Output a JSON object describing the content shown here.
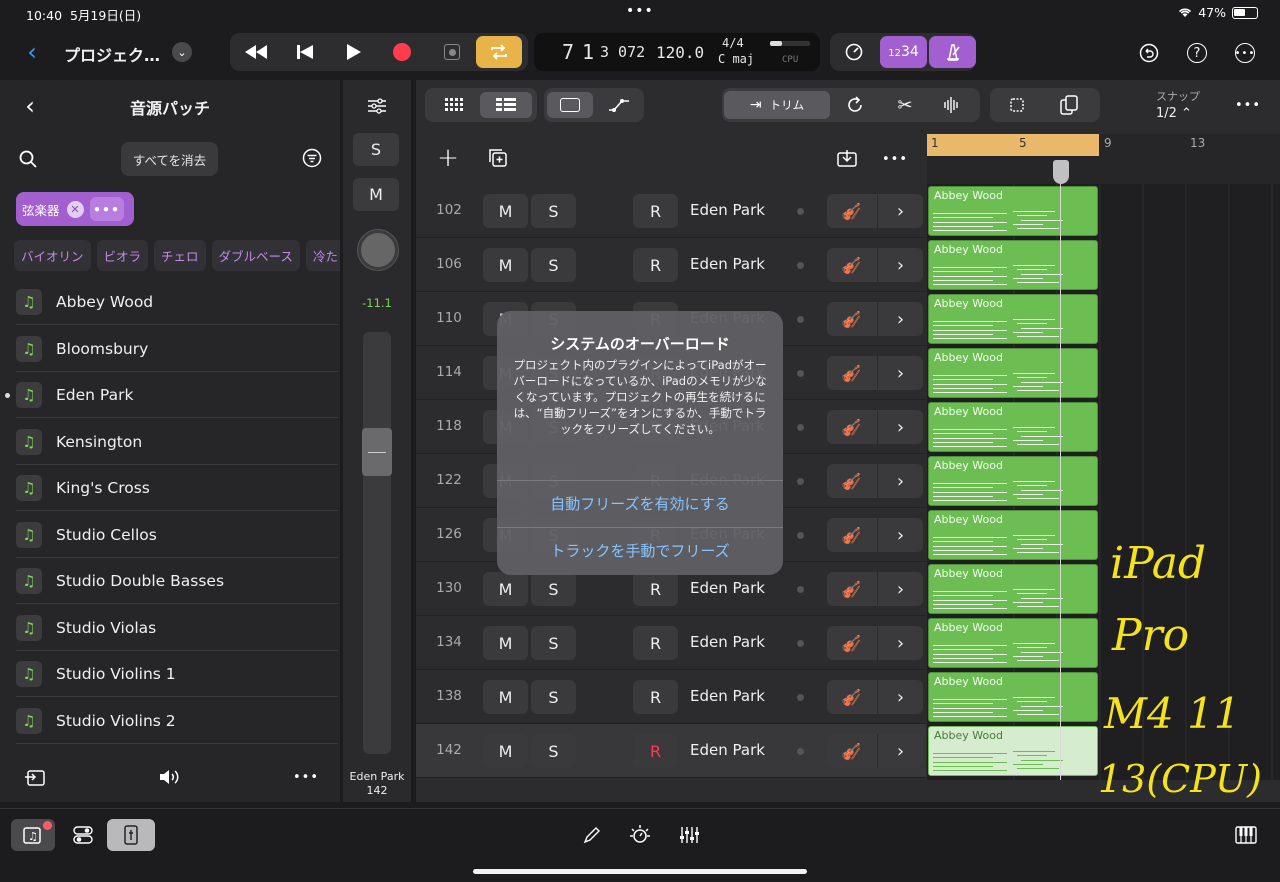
{
  "status": {
    "time": "10:40",
    "date": "5月19日(日)",
    "battery": "47%"
  },
  "toolbar": {
    "project_name": "プロジェク…",
    "count_in": "1234"
  },
  "lcd": {
    "bar": "7",
    "beat": "1",
    "ticks": "3 072",
    "tempo": "120.0",
    "signature": "4/4",
    "key": "C maj",
    "cpu": "CPU"
  },
  "left_panel": {
    "title": "音源パッチ",
    "clear_label": "すべてを消去",
    "filter_chip": "弦楽器",
    "categories": [
      "バイオリン",
      "ビオラ",
      "チェロ",
      "ダブルベース",
      "冷た"
    ],
    "patches": [
      "Abbey Wood",
      "Bloomsbury",
      "Eden Park",
      "Kensington",
      "King's Cross",
      "Studio Cellos",
      "Studio Double Basses",
      "Studio Violas",
      "Studio Violins 1",
      "Studio Violins 2"
    ],
    "selected_patch": "Eden Park"
  },
  "mixer": {
    "solo": "S",
    "mute": "M",
    "level": "-11.1",
    "track_name": "Eden Park",
    "track_number": "142"
  },
  "editor": {
    "trim_label": "トリム",
    "snap_label": "スナップ",
    "snap_value": "1/2",
    "ruler": [
      "1",
      "5",
      "9",
      "13"
    ],
    "mute": "M",
    "solo": "S",
    "record": "R"
  },
  "tracks": [
    {
      "num": "102",
      "name": "Eden Park",
      "region": "Abbey Wood"
    },
    {
      "num": "106",
      "name": "Eden Park",
      "region": "Abbey Wood"
    },
    {
      "num": "110",
      "name": "Eden Park",
      "region": "Abbey Wood"
    },
    {
      "num": "114",
      "name": "Eden Park",
      "region": "Abbey Wood"
    },
    {
      "num": "118",
      "name": "Eden Park",
      "region": "Abbey Wood"
    },
    {
      "num": "122",
      "name": "Eden Park",
      "region": "Abbey Wood"
    },
    {
      "num": "126",
      "name": "Eden Park",
      "region": "Abbey Wood"
    },
    {
      "num": "130",
      "name": "Eden Park",
      "region": "Abbey Wood"
    },
    {
      "num": "134",
      "name": "Eden Park",
      "region": "Abbey Wood"
    },
    {
      "num": "138",
      "name": "Eden Park",
      "region": "Abbey Wood"
    },
    {
      "num": "142",
      "name": "Eden Park",
      "region": "Abbey Wood"
    }
  ],
  "dialog": {
    "title": "システムのオーバーロード",
    "message": "プロジェクト内のプラグインによってiPadがオーバーロードになっているか、iPadのメモリが少なくなっています。プロジェクトの再生を続けるには、“自動フリーズ”をオンにするか、手動でトラックをフリーズしてください。",
    "button_auto": "自動フリーズを有効にする",
    "button_manual": "トラックを手動でフリーズ"
  },
  "handwriting": [
    "iPad",
    "Pro",
    "M4 11",
    "13(CPU)"
  ],
  "colors": {
    "accent_purple": "#a25fd0",
    "record_red": "#ff3b4e",
    "cycle_yellow": "#e8b44a",
    "region_green": "#6dbe52",
    "ruler_orange": "#eab86a",
    "link_blue": "#86c4ff"
  }
}
